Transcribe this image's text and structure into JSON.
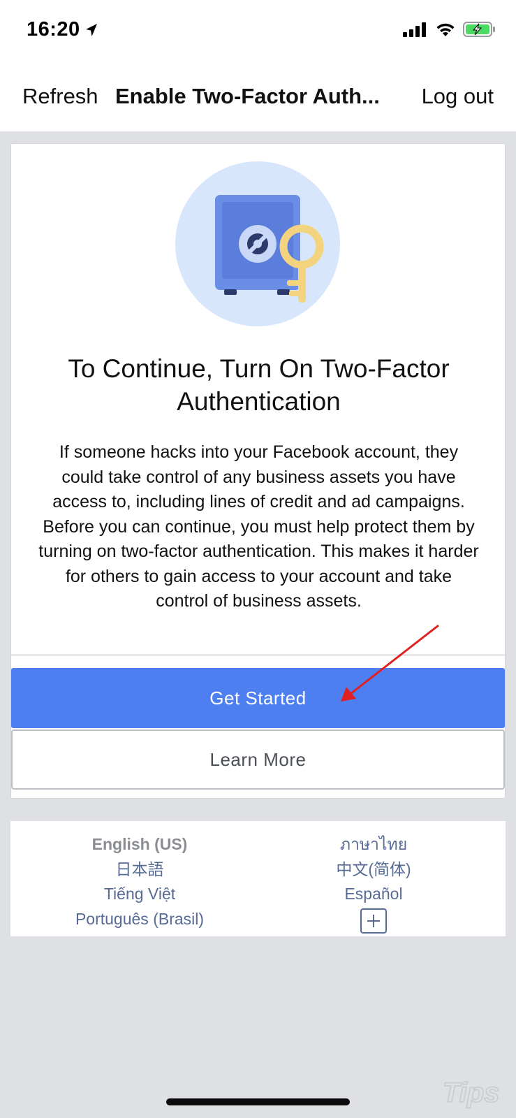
{
  "status_bar": {
    "time": "16:20",
    "location_icon": "navigation-arrow-icon",
    "signal_icon": "cellular-signal-icon",
    "wifi_icon": "wifi-icon",
    "battery_icon": "battery-charging-icon",
    "battery_color": "#4cd964"
  },
  "nav": {
    "left_label": "Refresh",
    "title": "Enable Two-Factor Auth...",
    "right_label": "Log out"
  },
  "card": {
    "hero_icon": "safe-with-key-icon",
    "heading": "To Continue, Turn On Two-Factor Authentication",
    "body": "If someone hacks into your Facebook account, they could take control of any business assets you have access to, including lines of credit and ad campaigns. Before you can continue, you must help protect them by turning on two-factor authentication. This makes it harder for others to gain access to your account and take control of business assets.",
    "primary_button": "Get Started",
    "secondary_button": "Learn More"
  },
  "colors": {
    "accent": "#4e7ff1",
    "link": "#576b95",
    "annotation_arrow": "#e02020"
  },
  "languages": {
    "left": [
      "English (US)",
      "日本語",
      "Tiếng Việt",
      "Português (Brasil)"
    ],
    "right": [
      "ภาษาไทย",
      "中文(简体)",
      "Español"
    ],
    "current": "English (US)",
    "more_icon": "plus-icon"
  },
  "watermark": "Tips"
}
